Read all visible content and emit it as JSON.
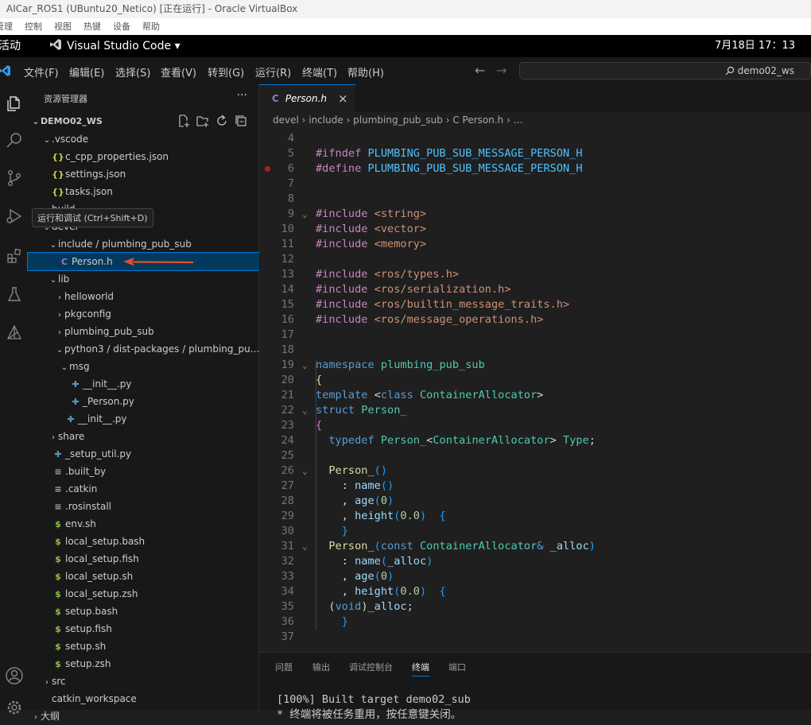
{
  "window": {
    "title": "AICar_ROS1 (UBuntu20_Netico) [正在运行] - Oracle VirtualBox"
  },
  "vbox_menu": [
    "管理",
    "控制",
    "视图",
    "热键",
    "设备",
    "帮助"
  ],
  "gnome": {
    "activities": "活动",
    "app_name": "Visual Studio Code",
    "app_arrow": "▾",
    "clock": "7月18日  17：13"
  },
  "menubar": [
    "文件(F)",
    "编辑(E)",
    "选择(S)",
    "查看(V)",
    "转到(G)",
    "运行(R)",
    "终端(T)",
    "帮助(H)"
  ],
  "command_center": {
    "text": "demo02_ws"
  },
  "explorer": {
    "title": "资源管理器",
    "more": "···",
    "workspace": "DEMO02_WS",
    "tooltip": "运行和调试 (Ctrl+Shift+D)",
    "rows": [
      {
        "label": "DEMO02_WS",
        "twistie": "⌄",
        "icon": "",
        "color": "#ccc"
      },
      {
        "label": ".vscode",
        "twistie": "⌄",
        "icon": "",
        "color": "#ccc"
      },
      {
        "label": "c_cpp_properties.json",
        "twistie": "",
        "icon": "{}",
        "color": "#cbcb41"
      },
      {
        "label": "settings.json",
        "twistie": "",
        "icon": "{}",
        "color": "#cbcb41"
      },
      {
        "label": "tasks.json",
        "twistie": "",
        "icon": "{}",
        "color": "#cbcb41"
      },
      {
        "label": "build",
        "twistie": "›",
        "icon": "",
        "color": "#ccc"
      },
      {
        "label": "devel",
        "twistie": "⌄",
        "icon": "",
        "color": "#ccc"
      },
      {
        "label": "include / plumbing_pub_sub",
        "twistie": "⌄",
        "icon": "",
        "color": "#ccc"
      },
      {
        "label": "Person.h",
        "twistie": "",
        "icon": "C",
        "color": "#a074c4"
      },
      {
        "label": "lib",
        "twistie": "⌄",
        "icon": "",
        "color": "#ccc"
      },
      {
        "label": "helloworld",
        "twistie": "›",
        "icon": "",
        "color": "#ccc"
      },
      {
        "label": "pkgconfig",
        "twistie": "›",
        "icon": "",
        "color": "#ccc"
      },
      {
        "label": "plumbing_pub_sub",
        "twistie": "›",
        "icon": "",
        "color": "#ccc"
      },
      {
        "label": "python3 / dist-packages / plumbing_pu...",
        "twistie": "⌄",
        "icon": "",
        "color": "#ccc"
      },
      {
        "label": "msg",
        "twistie": "⌄",
        "icon": "",
        "color": "#ccc"
      },
      {
        "label": "__init__.py",
        "twistie": "",
        "icon": "✚",
        "color": "#519aba"
      },
      {
        "label": "_Person.py",
        "twistie": "",
        "icon": "✚",
        "color": "#519aba"
      },
      {
        "label": "__init__.py",
        "twistie": "",
        "icon": "✚",
        "color": "#519aba"
      },
      {
        "label": "share",
        "twistie": "›",
        "icon": "",
        "color": "#ccc"
      },
      {
        "label": "_setup_util.py",
        "twistie": "",
        "icon": "✚",
        "color": "#519aba"
      },
      {
        "label": ".built_by",
        "twistie": "",
        "icon": "≡",
        "color": "#aaa"
      },
      {
        "label": ".catkin",
        "twistie": "",
        "icon": "≡",
        "color": "#aaa"
      },
      {
        "label": ".rosinstall",
        "twistie": "",
        "icon": "≡",
        "color": "#aaa"
      },
      {
        "label": "env.sh",
        "twistie": "",
        "icon": "$",
        "color": "#8dc149"
      },
      {
        "label": "local_setup.bash",
        "twistie": "",
        "icon": "$",
        "color": "#8dc149"
      },
      {
        "label": "local_setup.fish",
        "twistie": "",
        "icon": "$",
        "color": "#8dc149"
      },
      {
        "label": "local_setup.sh",
        "twistie": "",
        "icon": "$",
        "color": "#8dc149"
      },
      {
        "label": "local_setup.zsh",
        "twistie": "",
        "icon": "$",
        "color": "#8dc149"
      },
      {
        "label": "setup.bash",
        "twistie": "",
        "icon": "$",
        "color": "#8dc149"
      },
      {
        "label": "setup.fish",
        "twistie": "",
        "icon": "$",
        "color": "#8dc149"
      },
      {
        "label": "setup.sh",
        "twistie": "",
        "icon": "$",
        "color": "#8dc149"
      },
      {
        "label": "setup.zsh",
        "twistie": "",
        "icon": "$",
        "color": "#8dc149"
      },
      {
        "label": "src",
        "twistie": "›",
        "icon": "",
        "color": "#ccc"
      },
      {
        "label": "catkin_workspace",
        "twistie": "",
        "icon": "",
        "color": "#ccc"
      },
      {
        "label": "大纲",
        "twistie": "›",
        "icon": "",
        "color": "#ccc"
      }
    ]
  },
  "editor": {
    "tab": {
      "icon": "C",
      "label": "Person.h",
      "close": "×"
    },
    "breadcrumb": "devel  ›  include  ›  plumbing_pub_sub  ›  C  Person.h  ›  …",
    "lines": [
      {
        "n": "3",
        "fold": "",
        "bp": false,
        "seg": []
      },
      {
        "n": "4",
        "fold": "",
        "bp": false,
        "seg": []
      },
      {
        "n": "5",
        "fold": "",
        "bp": false,
        "seg": [
          [
            "k",
            "#ifndef "
          ],
          [
            "m",
            "PLUMBING_PUB_SUB_MESSAGE_PERSON_H"
          ]
        ]
      },
      {
        "n": "6",
        "fold": "",
        "bp": true,
        "seg": [
          [
            "k",
            "#define "
          ],
          [
            "m",
            "PLUMBING_PUB_SUB_MESSAGE_PERSON_H"
          ]
        ]
      },
      {
        "n": "7",
        "fold": "",
        "bp": false,
        "seg": []
      },
      {
        "n": "8",
        "fold": "",
        "bp": false,
        "seg": []
      },
      {
        "n": "9",
        "fold": "⌄",
        "bp": false,
        "seg": [
          [
            "k",
            "#include "
          ],
          [
            "s",
            "<string>"
          ]
        ]
      },
      {
        "n": "10",
        "fold": "",
        "bp": false,
        "seg": [
          [
            "k",
            "#include "
          ],
          [
            "s",
            "<vector>"
          ]
        ]
      },
      {
        "n": "11",
        "fold": "",
        "bp": false,
        "seg": [
          [
            "k",
            "#include "
          ],
          [
            "s",
            "<memory>"
          ]
        ]
      },
      {
        "n": "12",
        "fold": "",
        "bp": false,
        "seg": []
      },
      {
        "n": "13",
        "fold": "",
        "bp": false,
        "seg": [
          [
            "k",
            "#include "
          ],
          [
            "s",
            "<ros/types.h>"
          ]
        ]
      },
      {
        "n": "14",
        "fold": "",
        "bp": false,
        "seg": [
          [
            "k",
            "#include "
          ],
          [
            "s",
            "<ros/serialization.h>"
          ]
        ]
      },
      {
        "n": "15",
        "fold": "",
        "bp": false,
        "seg": [
          [
            "k",
            "#include "
          ],
          [
            "s",
            "<ros/builtin_message_traits.h>"
          ]
        ]
      },
      {
        "n": "16",
        "fold": "",
        "bp": false,
        "seg": [
          [
            "k",
            "#include "
          ],
          [
            "s",
            "<ros/message_operations.h>"
          ]
        ]
      },
      {
        "n": "17",
        "fold": "",
        "bp": false,
        "seg": []
      },
      {
        "n": "18",
        "fold": "",
        "bp": false,
        "seg": []
      },
      {
        "n": "19",
        "fold": "⌄",
        "bp": false,
        "seg": [
          [
            "kb",
            "namespace "
          ],
          [
            "t",
            "plumbing_pub_sub"
          ]
        ]
      },
      {
        "n": "20",
        "fold": "",
        "bp": false,
        "seg": [
          [
            "y",
            "{"
          ]
        ]
      },
      {
        "n": "21",
        "fold": "",
        "bp": false,
        "seg": [
          [
            "kb",
            "template "
          ],
          [
            "p",
            "<"
          ],
          [
            "kb",
            "class "
          ],
          [
            "t",
            "ContainerAllocator"
          ],
          [
            "p",
            ">"
          ]
        ]
      },
      {
        "n": "22",
        "fold": "⌄",
        "bp": false,
        "seg": [
          [
            "kb",
            "struct "
          ],
          [
            "t",
            "Person_"
          ]
        ]
      },
      {
        "n": "23",
        "fold": "",
        "bp": false,
        "seg": [
          [
            "b1",
            "{"
          ]
        ]
      },
      {
        "n": "24",
        "fold": "",
        "bp": false,
        "seg": [
          [
            "p",
            "  "
          ],
          [
            "kb",
            "typedef "
          ],
          [
            "t",
            "Person_"
          ],
          [
            "p",
            "<"
          ],
          [
            "t",
            "ContainerAllocator"
          ],
          [
            "p",
            "> "
          ],
          [
            "t",
            "Type"
          ],
          [
            "p",
            ";"
          ]
        ]
      },
      {
        "n": "25",
        "fold": "",
        "bp": false,
        "seg": []
      },
      {
        "n": "26",
        "fold": "⌄",
        "bp": false,
        "seg": [
          [
            "p",
            "  "
          ],
          [
            "y",
            "Person_"
          ],
          [
            "b2",
            "()"
          ]
        ]
      },
      {
        "n": "27",
        "fold": "",
        "bp": false,
        "seg": [
          [
            "p",
            "    : "
          ],
          [
            "v",
            "name"
          ],
          [
            "b2",
            "()"
          ]
        ]
      },
      {
        "n": "28",
        "fold": "",
        "bp": false,
        "seg": [
          [
            "p",
            "    , "
          ],
          [
            "v",
            "age"
          ],
          [
            "b2",
            "("
          ],
          [
            "n",
            "0"
          ],
          [
            "b2",
            ")"
          ]
        ]
      },
      {
        "n": "29",
        "fold": "",
        "bp": false,
        "seg": [
          [
            "p",
            "    , "
          ],
          [
            "v",
            "height"
          ],
          [
            "b2",
            "("
          ],
          [
            "n",
            "0.0"
          ],
          [
            "b2",
            ")"
          ],
          [
            "p",
            "  "
          ],
          [
            "b2",
            "{"
          ]
        ]
      },
      {
        "n": "30",
        "fold": "",
        "bp": false,
        "seg": [
          [
            "p",
            "    "
          ],
          [
            "b2",
            "}"
          ]
        ]
      },
      {
        "n": "31",
        "fold": "⌄",
        "bp": false,
        "seg": [
          [
            "p",
            "  "
          ],
          [
            "y",
            "Person_"
          ],
          [
            "b2",
            "("
          ],
          [
            "kb",
            "const "
          ],
          [
            "t",
            "ContainerAllocator"
          ],
          [
            "kb",
            "& "
          ],
          [
            "v",
            "_alloc"
          ],
          [
            "b2",
            ")"
          ]
        ]
      },
      {
        "n": "32",
        "fold": "",
        "bp": false,
        "seg": [
          [
            "p",
            "    : "
          ],
          [
            "v",
            "name"
          ],
          [
            "b2",
            "("
          ],
          [
            "v",
            "_alloc"
          ],
          [
            "b2",
            ")"
          ]
        ]
      },
      {
        "n": "33",
        "fold": "",
        "bp": false,
        "seg": [
          [
            "p",
            "    , "
          ],
          [
            "v",
            "age"
          ],
          [
            "b2",
            "("
          ],
          [
            "n",
            "0"
          ],
          [
            "b2",
            ")"
          ]
        ]
      },
      {
        "n": "34",
        "fold": "",
        "bp": false,
        "seg": [
          [
            "p",
            "    , "
          ],
          [
            "v",
            "height"
          ],
          [
            "b2",
            "("
          ],
          [
            "n",
            "0.0"
          ],
          [
            "b2",
            ")"
          ],
          [
            "p",
            "  "
          ],
          [
            "b2",
            "{"
          ]
        ]
      },
      {
        "n": "35",
        "fold": "",
        "bp": false,
        "seg": [
          [
            "p",
            "  "
          ],
          [
            "y",
            "("
          ],
          [
            "kb",
            "void"
          ],
          [
            "y",
            ")"
          ],
          [
            "v",
            "_alloc"
          ],
          [
            "p",
            ";"
          ]
        ]
      },
      {
        "n": "36",
        "fold": "",
        "bp": false,
        "seg": [
          [
            "p",
            "    "
          ],
          [
            "b2",
            "}"
          ]
        ]
      },
      {
        "n": "37",
        "fold": "",
        "bp": false,
        "seg": []
      }
    ]
  },
  "panel": {
    "tabs": [
      "问题",
      "输出",
      "调试控制台",
      "终端",
      "端口"
    ],
    "active_tab": "终端",
    "terminal_lines": [
      "[100%] Built target demo02_sub",
      " *  终端将被任务重用，按任意键关闭。"
    ]
  },
  "colors": {
    "accent": "#0078d4",
    "arrow": "#e0502a"
  }
}
